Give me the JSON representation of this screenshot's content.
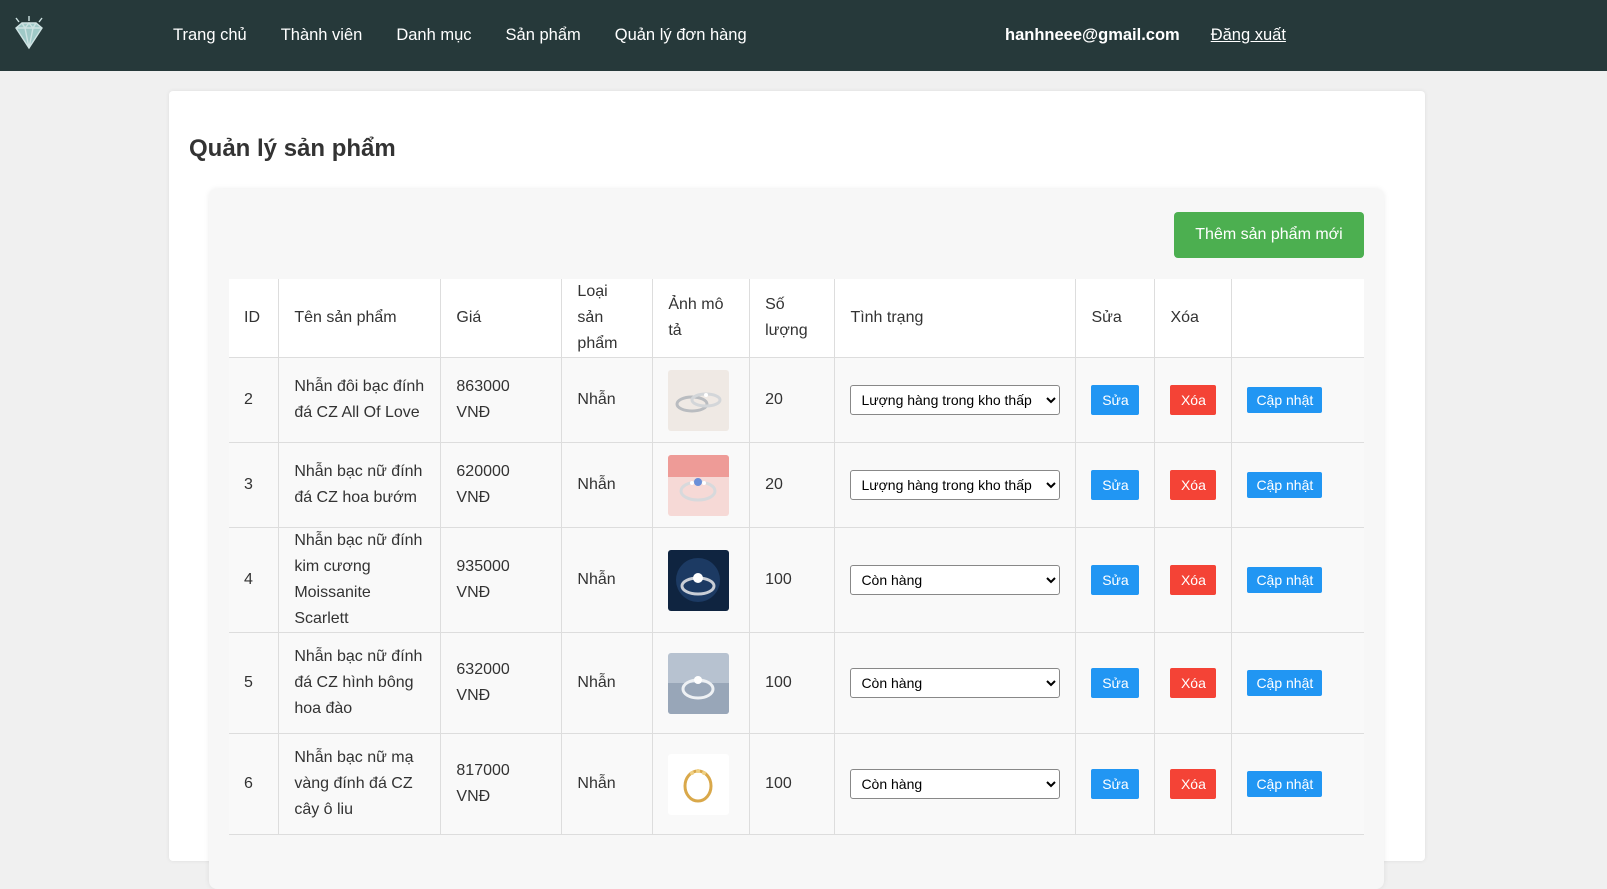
{
  "nav": {
    "links": [
      "Trang chủ",
      "Thành viên",
      "Danh mục",
      "Sản phẩm",
      "Quản lý đơn hàng"
    ],
    "email": "hanhneee@gmail.com",
    "logout": "Đăng xuất"
  },
  "page": {
    "title": "Quản lý sản phẩm",
    "add_button": "Thêm sản phẩm mới"
  },
  "table": {
    "headers": [
      "ID",
      "Tên sản phẩm",
      "Giá",
      "Loại sản phẩm",
      "Ảnh mô tả",
      "Số lượng",
      "Tình trạng",
      "Sửa",
      "Xóa",
      ""
    ],
    "rows": [
      {
        "id": "2",
        "name": "Nhẫn đôi bạc đính đá CZ All Of Love",
        "price": "863000 VNĐ",
        "category": "Nhẫn",
        "image": "ring-couple-silver",
        "qty": "20",
        "status": "Lượng hàng trong kho thấp",
        "edit": "Sửa",
        "delete": "Xóa",
        "update": "Cập nhật"
      },
      {
        "id": "3",
        "name": "Nhẫn bạc nữ đính đá CZ hoa bướm",
        "price": "620000 VNĐ",
        "category": "Nhẫn",
        "image": "ring-butterfly",
        "qty": "20",
        "status": "Lượng hàng trong kho thấp",
        "edit": "Sửa",
        "delete": "Xóa",
        "update": "Cập nhật"
      },
      {
        "id": "4",
        "name": "Nhẫn bạc nữ đính kim cương Moissanite Scarlett",
        "price": "935000 VNĐ",
        "category": "Nhẫn",
        "image": "ring-moissanite-dark",
        "qty": "100",
        "status": "Còn hàng",
        "edit": "Sửa",
        "delete": "Xóa",
        "update": "Cập nhật"
      },
      {
        "id": "5",
        "name": "Nhẫn bạc nữ đính đá CZ hình bông hoa đào",
        "price": "632000 VNĐ",
        "category": "Nhẫn",
        "image": "ring-peach-blossom",
        "qty": "100",
        "status": "Còn hàng",
        "edit": "Sửa",
        "delete": "Xóa",
        "update": "Cập nhật"
      },
      {
        "id": "6",
        "name": "Nhẫn bạc nữ mạ vàng đính đá CZ cây ô liu",
        "price": "817000 VNĐ",
        "category": "Nhẫn",
        "image": "ring-olive-gold",
        "qty": "100",
        "status": "Còn hàng",
        "edit": "Sửa",
        "delete": "Xóa",
        "update": "Cập nhật"
      }
    ]
  },
  "colors": {
    "navbar": "#26393a",
    "add_button": "#4caf50",
    "edit_button": "#2196f3",
    "delete_button": "#f44336"
  }
}
